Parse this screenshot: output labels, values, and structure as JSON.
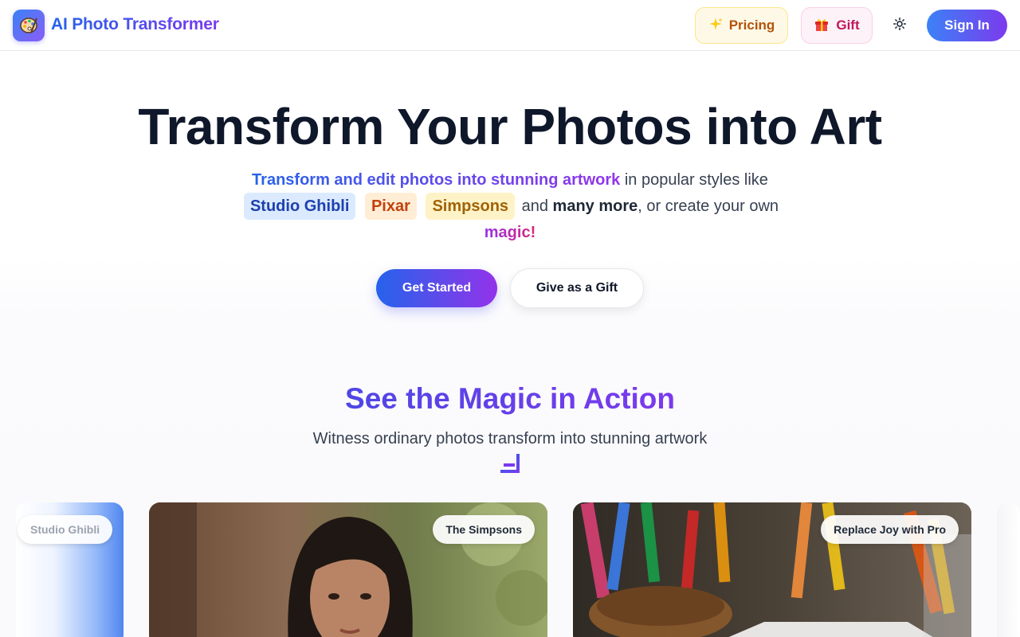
{
  "header": {
    "brand": "AI Photo Transformer",
    "logo_icon": "palette-icon",
    "pricing_label": "Pricing",
    "pricing_icon": "sparkles-icon",
    "gift_label": "Gift",
    "gift_icon": "gift-icon",
    "theme_icon": "sun-icon",
    "signin_label": "Sign In"
  },
  "hero": {
    "title": "Transform Your Photos into Art",
    "sub_lead": "Transform and edit photos into stunning artwork",
    "sub_mid": " in popular styles like",
    "tags": [
      "Studio Ghibli",
      "Pixar",
      "Simpsons"
    ],
    "sub_and": "and",
    "sub_many": "many more",
    "sub_tail": ", or create your own",
    "sub_magic": "magic!",
    "cta_primary": "Get Started",
    "cta_secondary": "Give as a Gift"
  },
  "showcase": {
    "title": "See the Magic in Action",
    "subtitle": "Witness ordinary photos transform into stunning artwork",
    "cards": [
      {
        "label": "Studio Ghibli"
      },
      {
        "label": "The Simpsons"
      },
      {
        "label": "Replace Joy with Pro"
      }
    ]
  },
  "colors": {
    "accent_blue": "#2563eb",
    "accent_purple": "#7c3aed",
    "pricing_text": "#b45309",
    "gift_text": "#be185d"
  }
}
